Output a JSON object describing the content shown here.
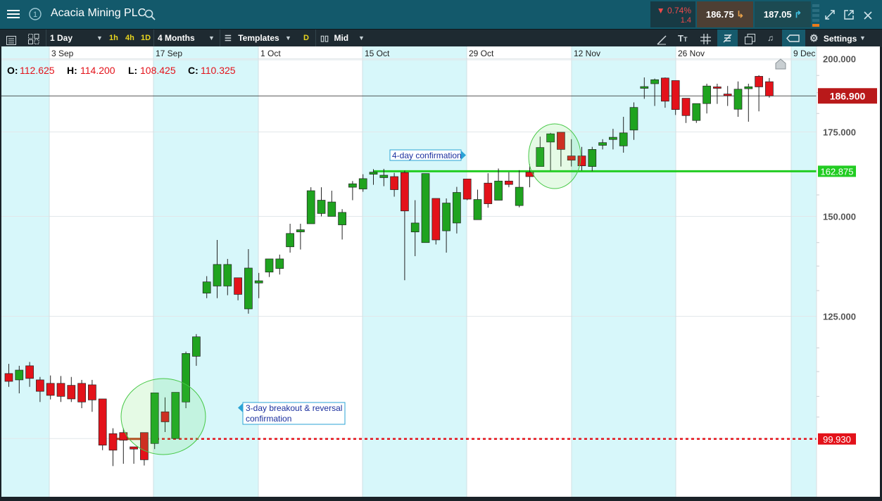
{
  "header": {
    "instrument": "Acacia Mining PLC",
    "change_pct": "▼ 0.74%",
    "change_abs": "1.4",
    "sell_price": "186.75",
    "buy_price": "187.05"
  },
  "toolbar": {
    "interval": "1 Day",
    "quick_1h": "1h",
    "quick_4h": "4h",
    "quick_1d": "1D",
    "range": "4 Months",
    "templates": "Templates",
    "d_badge": "D",
    "price_type": "Mid",
    "settings": "Settings"
  },
  "ohlc": {
    "o_label": "O:",
    "o": "112.625",
    "h_label": "H:",
    "h": "114.200",
    "l_label": "L:",
    "l": "108.425",
    "c_label": "C:",
    "c": "110.325"
  },
  "colors": {
    "up": "#1fa31f",
    "down": "#e3121a",
    "shade": "#d7f7fa",
    "current_price": "#b9191a",
    "resistance": "#22cc22",
    "breakout": "#e3121a"
  },
  "chart_data": {
    "type": "candlestick",
    "title": "Acacia Mining PLC",
    "x_ticks": [
      "3 Sep",
      "17 Sep",
      "1 Oct",
      "15 Oct",
      "29 Oct",
      "12 Nov",
      "26 Nov",
      "9 Dec"
    ],
    "y_ticks": [
      "100.000",
      "125.000",
      "150.000",
      "175.000",
      "200.000"
    ],
    "ylim": [
      96,
      200
    ],
    "scale": "log",
    "current_price": {
      "value": 186.9,
      "label": "186.900"
    },
    "levels": [
      {
        "value": 162.875,
        "label": "162.875",
        "style": "solid",
        "color": "#22cc22"
      },
      {
        "value": 99.93,
        "label": "99.930",
        "style": "dotted",
        "color": "#e3121a"
      }
    ],
    "annotations": [
      {
        "text": "4-day confirmation"
      },
      {
        "text": "3-day breakout & reversal confirmation"
      }
    ],
    "candles": [
      {
        "o": 112.6,
        "h": 114.6,
        "l": 109.9,
        "c": 111.0
      },
      {
        "o": 111.3,
        "h": 114.2,
        "l": 108.6,
        "c": 113.3
      },
      {
        "o": 114.2,
        "h": 115.0,
        "l": 109.9,
        "c": 111.6
      },
      {
        "o": 111.3,
        "h": 111.9,
        "l": 106.9,
        "c": 109.0
      },
      {
        "o": 110.6,
        "h": 112.2,
        "l": 107.4,
        "c": 108.2
      },
      {
        "o": 110.6,
        "h": 112.1,
        "l": 106.9,
        "c": 108.0
      },
      {
        "o": 110.2,
        "h": 111.9,
        "l": 106.9,
        "c": 107.5
      },
      {
        "o": 110.6,
        "h": 111.3,
        "l": 105.7,
        "c": 106.9
      },
      {
        "o": 110.3,
        "h": 111.3,
        "l": 105.0,
        "c": 107.3
      },
      {
        "o": 107.5,
        "h": 107.5,
        "l": 97.9,
        "c": 98.8
      },
      {
        "o": 100.9,
        "h": 101.9,
        "l": 95.1,
        "c": 97.9
      },
      {
        "o": 101.1,
        "h": 101.9,
        "l": 95.5,
        "c": 99.7
      },
      {
        "o": 98.5,
        "h": 98.5,
        "l": 95.5,
        "c": 98.1
      },
      {
        "o": 101.1,
        "h": 101.1,
        "l": 95.2,
        "c": 96.2
      },
      {
        "o": 99.1,
        "h": 105.0,
        "l": 98.1,
        "c": 108.7
      },
      {
        "o": 105.0,
        "h": 107.8,
        "l": 101.2,
        "c": 103.1
      },
      {
        "o": 100.0,
        "h": 107.8,
        "l": 100.0,
        "c": 108.8
      },
      {
        "o": 106.9,
        "h": 117.2,
        "l": 105.7,
        "c": 116.8
      },
      {
        "o": 116.2,
        "h": 121.0,
        "l": 114.2,
        "c": 120.4
      },
      {
        "o": 130.4,
        "h": 134.5,
        "l": 129.2,
        "c": 133.1
      },
      {
        "o": 132.1,
        "h": 143.7,
        "l": 129.2,
        "c": 137.4
      },
      {
        "o": 132.1,
        "h": 138.8,
        "l": 129.9,
        "c": 137.4
      },
      {
        "o": 134.1,
        "h": 134.1,
        "l": 128.7,
        "c": 130.1
      },
      {
        "o": 126.7,
        "h": 141.3,
        "l": 125.6,
        "c": 136.5
      },
      {
        "o": 133.0,
        "h": 135.3,
        "l": 129.2,
        "c": 133.2
      },
      {
        "o": 135.5,
        "h": 138.0,
        "l": 134.3,
        "c": 138.8
      },
      {
        "o": 136.4,
        "h": 139.9,
        "l": 134.9,
        "c": 138.8
      },
      {
        "o": 141.9,
        "h": 148.0,
        "l": 140.4,
        "c": 145.4
      },
      {
        "o": 146.0,
        "h": 148.0,
        "l": 141.2,
        "c": 146.2
      },
      {
        "o": 148.0,
        "h": 158.2,
        "l": 148.0,
        "c": 157.2
      },
      {
        "o": 150.8,
        "h": 158.2,
        "l": 150.0,
        "c": 154.5
      },
      {
        "o": 150.0,
        "h": 157.2,
        "l": 150.0,
        "c": 154.0
      },
      {
        "o": 147.7,
        "h": 152.0,
        "l": 143.8,
        "c": 151.1
      },
      {
        "o": 158.2,
        "h": 160.0,
        "l": 154.5,
        "c": 159.2
      },
      {
        "o": 157.7,
        "h": 162.0,
        "l": 156.9,
        "c": 160.7
      },
      {
        "o": 162.2,
        "h": 163.5,
        "l": 158.9,
        "c": 162.4
      },
      {
        "o": 161.2,
        "h": 163.6,
        "l": 158.5,
        "c": 161.5
      },
      {
        "o": 161.3,
        "h": 162.4,
        "l": 155.5,
        "c": 157.5
      },
      {
        "o": 162.5,
        "h": 163.1,
        "l": 133.5,
        "c": 151.5
      },
      {
        "o": 145.8,
        "h": 154.5,
        "l": 139.5,
        "c": 148.2
      },
      {
        "o": 143.0,
        "h": 162.2,
        "l": 143.0,
        "c": 162.2
      },
      {
        "o": 155.0,
        "h": 155.0,
        "l": 142.5,
        "c": 143.7
      },
      {
        "o": 146.1,
        "h": 155.0,
        "l": 140.4,
        "c": 153.7
      },
      {
        "o": 148.2,
        "h": 158.3,
        "l": 145.4,
        "c": 156.7
      },
      {
        "o": 160.6,
        "h": 160.6,
        "l": 154.5,
        "c": 154.8
      },
      {
        "o": 149.1,
        "h": 157.5,
        "l": 149.1,
        "c": 154.7
      },
      {
        "o": 159.4,
        "h": 162.3,
        "l": 152.4,
        "c": 153.5
      },
      {
        "o": 154.5,
        "h": 163.7,
        "l": 154.5,
        "c": 160.0
      },
      {
        "o": 160.0,
        "h": 162.6,
        "l": 158.2,
        "c": 159.0
      },
      {
        "o": 153.0,
        "h": 163.2,
        "l": 152.5,
        "c": 158.2
      },
      {
        "o": 162.6,
        "h": 165.0,
        "l": 158.2,
        "c": 161.3
      },
      {
        "o": 164.3,
        "h": 173.5,
        "l": 164.3,
        "c": 170.1
      },
      {
        "o": 171.8,
        "h": 174.7,
        "l": 163.1,
        "c": 174.4
      },
      {
        "o": 174.9,
        "h": 174.9,
        "l": 164.3,
        "c": 169.5
      },
      {
        "o": 167.5,
        "h": 172.7,
        "l": 164.3,
        "c": 166.2
      },
      {
        "o": 167.5,
        "h": 170.3,
        "l": 163.1,
        "c": 164.5
      },
      {
        "o": 164.3,
        "h": 170.3,
        "l": 162.9,
        "c": 169.5
      },
      {
        "o": 171.0,
        "h": 172.7,
        "l": 169.5,
        "c": 171.4
      },
      {
        "o": 172.6,
        "h": 176.0,
        "l": 169.5,
        "c": 173.3
      },
      {
        "o": 170.6,
        "h": 179.9,
        "l": 168.5,
        "c": 174.7
      },
      {
        "o": 175.6,
        "h": 184.7,
        "l": 172.5,
        "c": 183.0
      },
      {
        "o": 189.5,
        "h": 193.3,
        "l": 185.9,
        "c": 190.1
      },
      {
        "o": 191.1,
        "h": 192.9,
        "l": 183.5,
        "c": 192.5
      },
      {
        "o": 193.1,
        "h": 193.3,
        "l": 182.9,
        "c": 185.1
      },
      {
        "o": 192.2,
        "h": 192.2,
        "l": 180.5,
        "c": 182.3
      },
      {
        "o": 186.1,
        "h": 186.1,
        "l": 177.9,
        "c": 180.3
      },
      {
        "o": 178.7,
        "h": 183.8,
        "l": 177.9,
        "c": 184.3
      },
      {
        "o": 184.3,
        "h": 191.1,
        "l": 181.0,
        "c": 190.3
      },
      {
        "o": 190.0,
        "h": 191.1,
        "l": 184.2,
        "c": 189.5
      },
      {
        "o": 187.3,
        "h": 190.3,
        "l": 183.5,
        "c": 187.2
      },
      {
        "o": 182.4,
        "h": 191.9,
        "l": 179.9,
        "c": 189.2
      },
      {
        "o": 189.6,
        "h": 191.1,
        "l": 178.3,
        "c": 189.8
      },
      {
        "o": 193.7,
        "h": 194.1,
        "l": 181.7,
        "c": 190.0
      },
      {
        "o": 191.8,
        "h": 193.1,
        "l": 186.3,
        "c": 186.9
      }
    ]
  }
}
